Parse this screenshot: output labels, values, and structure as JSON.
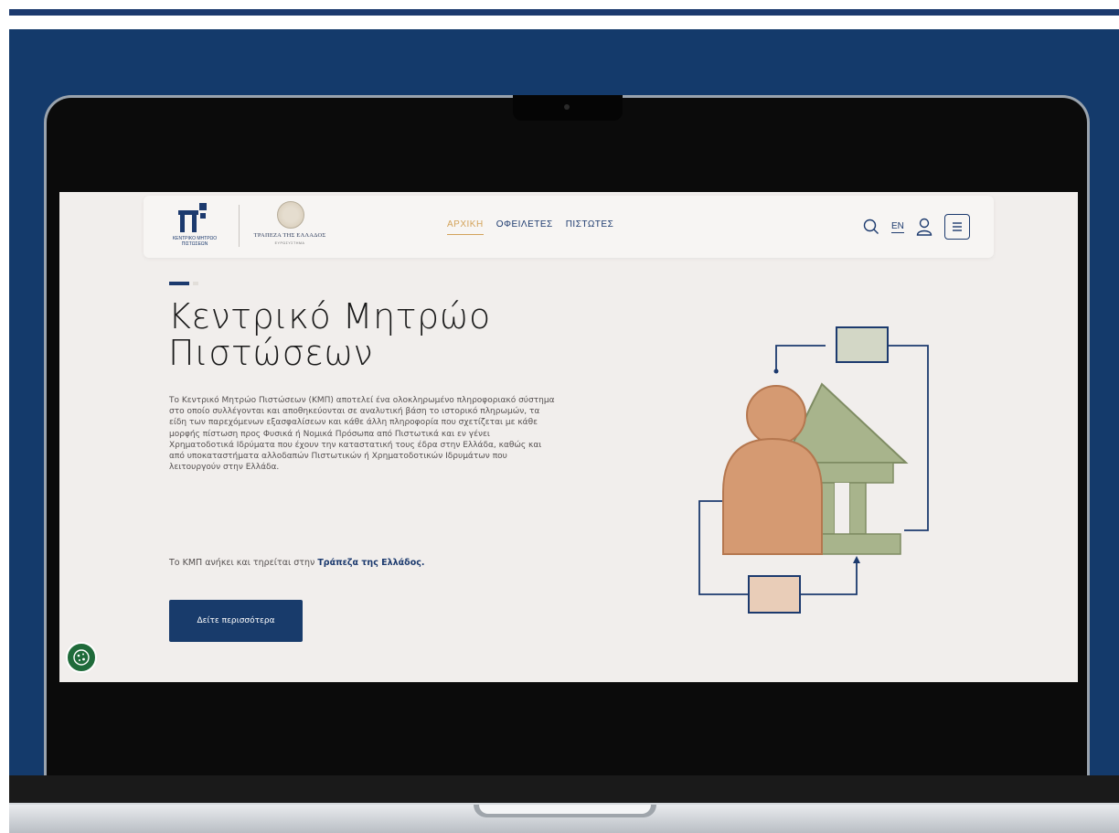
{
  "brand": {
    "kmp_logo_text": "ΚΕΝΤΡΙΚΟ ΜΗΤΡΩΟ ΠΙΣΤΩΣΕΩΝ",
    "boe_name": "ΤΡΑΠΕΖΑ ΤΗΣ ΕΛΛΑΔΟΣ",
    "boe_sub": "ΕΥΡΩΣΥΣΤΗΜΑ"
  },
  "nav": {
    "links": [
      {
        "label": "ΑΡΧΙΚΗ",
        "active": true
      },
      {
        "label": "ΟΦΕΙΛΕΤΕΣ",
        "active": false
      },
      {
        "label": "ΠΙΣΤΩΤΕΣ",
        "active": false
      }
    ],
    "lang": "EN",
    "icons": [
      "search-icon",
      "user-icon",
      "menu-icon"
    ]
  },
  "hero": {
    "title": "Κεντρικό Μητρώο Πιστώσεων",
    "body": "Το Κεντρικό Μητρώο Πιστώσεων (ΚΜΠ) αποτελεί ένα ολοκληρωμένο πληροφοριακό σύστημα στο οποίο συλλέγονται και αποθηκεύονται σε αναλυτική βάση το ιστορικό πληρωμών, τα είδη των παρεχόμενων εξασφαλίσεων και κάθε άλλη πληροφορία που σχετίζεται με κάθε μορφής πίστωση προς Φυσικά ή Νομικά Πρόσωπα από Πιστωτικά και εν γένει Χρηματοδοτικά Ιδρύματα που έχουν την καταστατική τους έδρα στην Ελλάδα, καθώς και από υποκαταστήματα αλλοδαπών Πιστωτικών ή Χρηματοδοτικών Ιδρυμάτων που λειτουργούν στην Ελλάδα.",
    "owned_prefix": "Το ΚΜΠ ανήκει και τηρείται στην ",
    "owned_link": "Τράπεζα της Ελλάδος.",
    "cta_label": "Δείτε περισσότερα"
  },
  "colors": {
    "primary": "#1c3a6e",
    "accent": "#d3a35a",
    "screen_bg": "#f1eeec",
    "person": "#d59a72",
    "building": "#a8b48c",
    "cookie": "#1f6b3a"
  }
}
